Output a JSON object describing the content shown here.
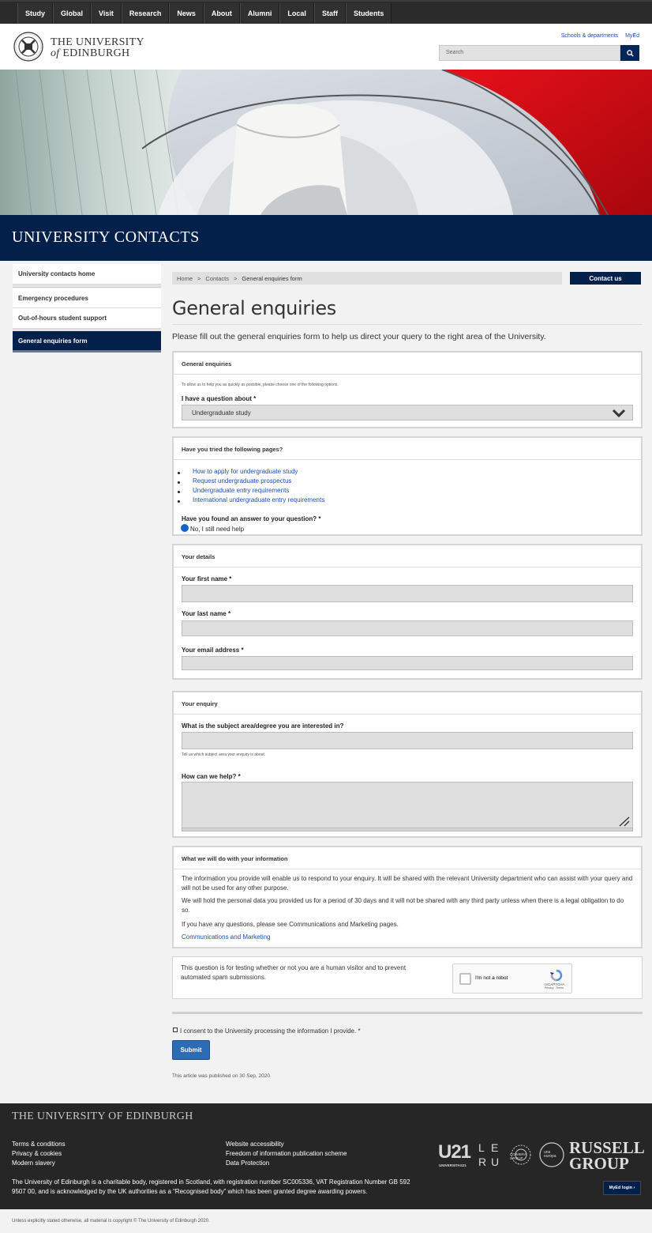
{
  "topnav": {
    "items": [
      "Study",
      "Global",
      "Visit",
      "Research",
      "News",
      "About",
      "Alumni",
      "Local",
      "Staff",
      "Students"
    ]
  },
  "header": {
    "uni_line1": "THE UNIVERSITY",
    "uni_line2_of": "of",
    "uni_line2_name": "EDINBURGH",
    "links": [
      "Schools & departments",
      "MyEd"
    ],
    "search_placeholder": "Search"
  },
  "section_title": "UNIVERSITY CONTACTS",
  "sidebar": {
    "items": [
      "University contacts home",
      "Emergency procedures",
      "Out-of-hours student support",
      "General enquiries form"
    ]
  },
  "breadcrumb": {
    "items": [
      "Home",
      "Contacts",
      "General enquiries form"
    ],
    "separator": ">"
  },
  "contact_button": "Contact us",
  "page_title": "General enquiries",
  "intro": "Please fill out the general enquiries form to help us direct your query to the right area of the University.",
  "panel_general": {
    "heading": "General enquiries",
    "help": "To allow us to help you as quickly as possible, please choose one of the following options.",
    "question_label": "I have a question about *",
    "selected": "Undergraduate study"
  },
  "panel_tried": {
    "heading": "Have you tried the following pages?",
    "links": [
      "How to apply for undergraduate study",
      "Request undergraduate prospectus",
      "Undergraduate entry requirements",
      "International undergraduate entry requirements"
    ],
    "answer_label": "Have you found an answer to your question? *",
    "radio_option": "No, I still need help"
  },
  "panel_details": {
    "heading": "Your details",
    "first_name": "Your first name *",
    "last_name": "Your last name *",
    "email": "Your email address *"
  },
  "panel_enquiry": {
    "heading": "Your enquiry",
    "subject_label": "What is the subject area/degree you are interested in?",
    "subject_help": "Tell us which subject area your enquiry is about.",
    "help_label": "How can we help? *"
  },
  "panel_info": {
    "heading": "What we will do with your information",
    "p1": "The information you provide will enable us to respond to your enquiry. It will be shared with the relevant University department who can assist with your query and will not be used for any other purpose.",
    "p2": "We will hold the personal data you provided us for a period of 30 days and it will not be shared with any third party unless when there is a legal obligation to do so.",
    "p3": "If you have any questions, please see Communications and Marketing pages.",
    "link": "Communications and Marketing"
  },
  "captcha": {
    "text": "This question is for testing whether or not you are a human visitor and to prevent automated spam submissions.",
    "label": "I'm not a robot",
    "brand": "reCAPTCHA",
    "brand_sub": "Privacy - Terms"
  },
  "consent": "I consent to the University processing the information I provide. *",
  "submit": "Submit",
  "published": "This article was published on 30 Sep, 2020",
  "footer": {
    "uni": "THE UNIVERSITY OF EDINBURGH",
    "col1": [
      "Terms & conditions",
      "Privacy & cookies",
      "Modern slavery"
    ],
    "col2": [
      "Website accessibility",
      "Freedom of information publication scheme",
      "Data Protection"
    ],
    "charity": "The University of Edinburgh is a charitable body, registered in Scotland, with registration number SC005336, VAT Registration Number GB 592 9507 00, and is acknowledged by the UK authorities as a “Recognised body” which has been granted degree awarding powers.",
    "logos": {
      "u21": "U21",
      "u21_sub": "UNIVERSITAS21",
      "leru": [
        "L",
        "E",
        "R",
        "U"
      ],
      "coimbra": "COIMBRA GROUP",
      "una": "una europa",
      "russell1": "RUSSELL",
      "russell2": "GROUP"
    },
    "myed": "MyEd login"
  },
  "copyright": "Unless explicitly stated otherwise, all material is copyright © The University of Edinburgh 2020.",
  "colors": {
    "navy": "#03204a",
    "link": "#1e4fb5",
    "submit": "#2e6bb5",
    "radio": "#1563c9"
  }
}
